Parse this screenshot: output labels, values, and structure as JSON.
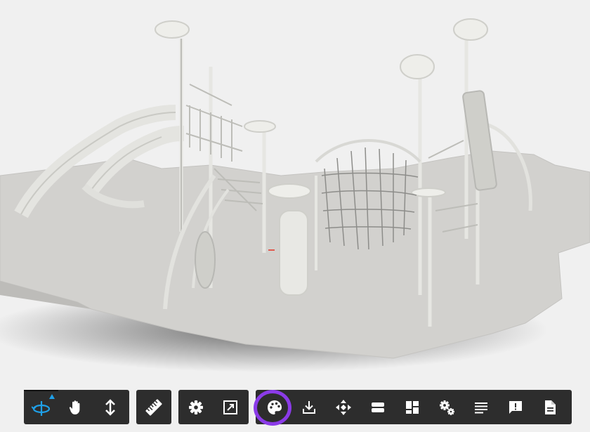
{
  "viewer": {
    "accent_color": "#1fa0e8",
    "highlight_color": "#8b3be8",
    "toolbar_color": "#2d2d2d",
    "icon_color": "#ffffff"
  },
  "toolbar": {
    "navigation": [
      {
        "name": "orbit-icon",
        "active": true
      },
      {
        "name": "pan-hand-icon",
        "active": false
      },
      {
        "name": "zoom-dolly-icon",
        "active": false
      }
    ],
    "measure": [
      {
        "name": "ruler-icon"
      }
    ],
    "view": [
      {
        "name": "settings-gear-icon"
      },
      {
        "name": "fullscreen-icon"
      }
    ],
    "tools": [
      {
        "name": "palette-icon",
        "highlighted": true
      },
      {
        "name": "download-icon"
      },
      {
        "name": "explode-move-icon"
      },
      {
        "name": "section-planes-icon"
      },
      {
        "name": "model-browser-icon"
      },
      {
        "name": "advanced-settings-icon"
      },
      {
        "name": "properties-list-icon"
      },
      {
        "name": "feedback-icon"
      },
      {
        "name": "document-icon"
      }
    ]
  }
}
